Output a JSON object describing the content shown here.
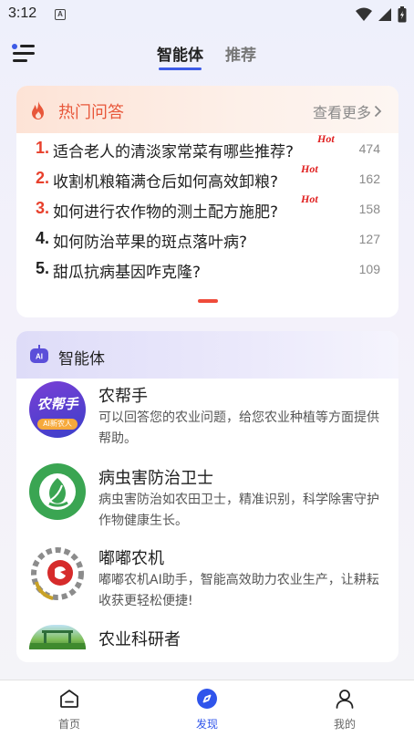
{
  "status_bar": {
    "time": "3:12",
    "indicator": "A"
  },
  "header": {
    "tabs": [
      {
        "label": "智能体",
        "active": true
      },
      {
        "label": "推荐",
        "active": false
      }
    ]
  },
  "hot_qa": {
    "title": "热门问答",
    "more_label": "查看更多",
    "items": [
      {
        "num": "1.",
        "text": "适合老人的清淡家常菜有哪些推荐?",
        "hot": "Hot",
        "count": "474"
      },
      {
        "num": "2.",
        "text": "收割机粮箱满仓后如何高效卸粮?",
        "hot": "Hot",
        "count": "162"
      },
      {
        "num": "3.",
        "text": "如何进行农作物的测土配方施肥?",
        "hot": "Hot",
        "count": "158"
      },
      {
        "num": "4.",
        "text": "如何防治苹果的斑点落叶病?",
        "hot": "",
        "count": "127"
      },
      {
        "num": "5.",
        "text": "甜瓜抗病基因咋克隆?",
        "hot": "",
        "count": "109"
      }
    ]
  },
  "agents": {
    "title": "智能体",
    "items": [
      {
        "name": "农帮手",
        "desc": "可以回答您的农业问题，给您农业种植等方面提供帮助。",
        "avatar_text": "农帮手",
        "avatar_sub": "AI新农人"
      },
      {
        "name": "病虫害防治卫士",
        "desc": "病虫害防治如农田卫士，精准识别，科学除害守护作物健康生长。"
      },
      {
        "name": "嘟嘟农机",
        "desc": "嘟嘟农机AI助手，智能高效助力农业生产，让耕耘收获更轻松便捷!"
      },
      {
        "name": "农业科研者",
        "desc": ""
      }
    ]
  },
  "bottom_nav": [
    {
      "label": "首页",
      "icon": "home-icon",
      "active": false
    },
    {
      "label": "发现",
      "icon": "compass-icon",
      "active": true
    },
    {
      "label": "我的",
      "icon": "person-icon",
      "active": false
    }
  ],
  "colors": {
    "accent": "#2f54eb",
    "hot": "#e8402c"
  }
}
